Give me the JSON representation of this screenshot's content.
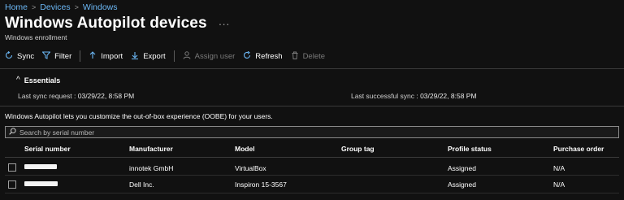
{
  "breadcrumb": [
    "Home",
    "Devices",
    "Windows"
  ],
  "header": {
    "title": "Windows Autopilot devices",
    "more_glyph": "···",
    "subtitle": "Windows enrollment"
  },
  "toolbar": {
    "sync": "Sync",
    "filter": "Filter",
    "import": "Import",
    "export": "Export",
    "assign_user": "Assign user",
    "refresh": "Refresh",
    "delete": "Delete"
  },
  "icons": {
    "sync": "sync-icon",
    "filter": "filter-icon",
    "import": "upload-icon",
    "export": "download-icon",
    "assign_user": "person-icon",
    "refresh": "refresh-icon",
    "delete": "trash-icon",
    "search": "search-icon"
  },
  "essentials": {
    "label": "Essentials",
    "last_sync_request_label": "Last sync request",
    "last_sync_request_value": "03/29/22, 8:58 PM",
    "last_successful_sync_label": "Last successful sync",
    "last_successful_sync_value": "03/29/22, 8:58 PM"
  },
  "intro_text": "Windows Autopilot lets you customize the out-of-box experience (OOBE) for your users.",
  "search": {
    "placeholder": "Search by serial number"
  },
  "table": {
    "columns": [
      "Serial number",
      "Manufacturer",
      "Model",
      "Group tag",
      "Profile status",
      "Purchase order"
    ],
    "rows": [
      {
        "manufacturer": "innotek GmbH",
        "model": "VirtualBox",
        "group_tag": "",
        "profile_status": "Assigned",
        "purchase_order": "N/A"
      },
      {
        "manufacturer": "Dell Inc.",
        "model": "Inspiron 15-3567",
        "group_tag": "",
        "profile_status": "Assigned",
        "purchase_order": "N/A"
      }
    ]
  },
  "colors": {
    "accent": "#6cb8f6",
    "background": "#111111"
  }
}
